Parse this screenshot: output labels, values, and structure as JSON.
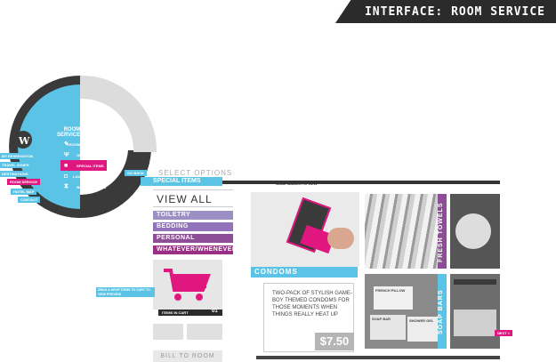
{
  "header": {
    "title": "INTERFACE: ROOM SERVICE"
  },
  "wheel": {
    "logo": "W",
    "title_line1": "ROOM",
    "title_line2": "SERVICE",
    "menu": [
      {
        "label": "ROOM MAINTENANCE",
        "icon": "wrench-icon"
      },
      {
        "label": "ORDER FOOD",
        "icon": "utensils-icon"
      },
      {
        "label": "SPECIAL ITEMS",
        "icon": "box-icon"
      },
      {
        "label": "LAUNDRY SERVICE",
        "icon": "camera-icon"
      },
      {
        "label": "WAKE-UP CALLS",
        "icon": "clock-icon"
      }
    ],
    "left_tags": [
      "MY RESERVATION",
      "TRAVEL ZONES",
      "DESTINATIONS",
      "ROOM SERVICE",
      "HOTEL MAP",
      "CONTACT"
    ],
    "go_back": "GO BACK"
  },
  "options": {
    "select_label": "SELECT OPTIONS",
    "special_items": "SPECIAL ITEMS",
    "view_all": "VIEW ALL",
    "categories": [
      "TOILETRY",
      "BEDDING",
      "PERSONAL",
      "WHATEVER/WHENEVER"
    ]
  },
  "cart": {
    "hint": "DRAG & DROP ITEMS TO CART TO VIEW PREVIEW",
    "items_label": "ITEMS IN CART",
    "count": "01",
    "bill_button": "BILL TO ROOM"
  },
  "gallery": {
    "slide_hint": "SLIDE IMAGES TO VIEW",
    "featured_title": "CONDOMS",
    "description": "TWO-PACK OF STYLISH GAME-BOY THEMED CONDOMS FOR THOSE MOMENTS WHEN THINGS REALLY HEAT UP",
    "price": "$7.50",
    "tiles": [
      "FRESH TOWELS",
      "SOAP BARS"
    ],
    "soap_labels": [
      "FRENCH PILLOW",
      "SOAP BAR",
      "SHOWER GEL"
    ],
    "next": "NEXT >"
  },
  "colors": {
    "accent_blue": "#5bc4e6",
    "pink": "#e0177f",
    "purple": "#8e4d97",
    "lavender": "#9b8fc4"
  }
}
